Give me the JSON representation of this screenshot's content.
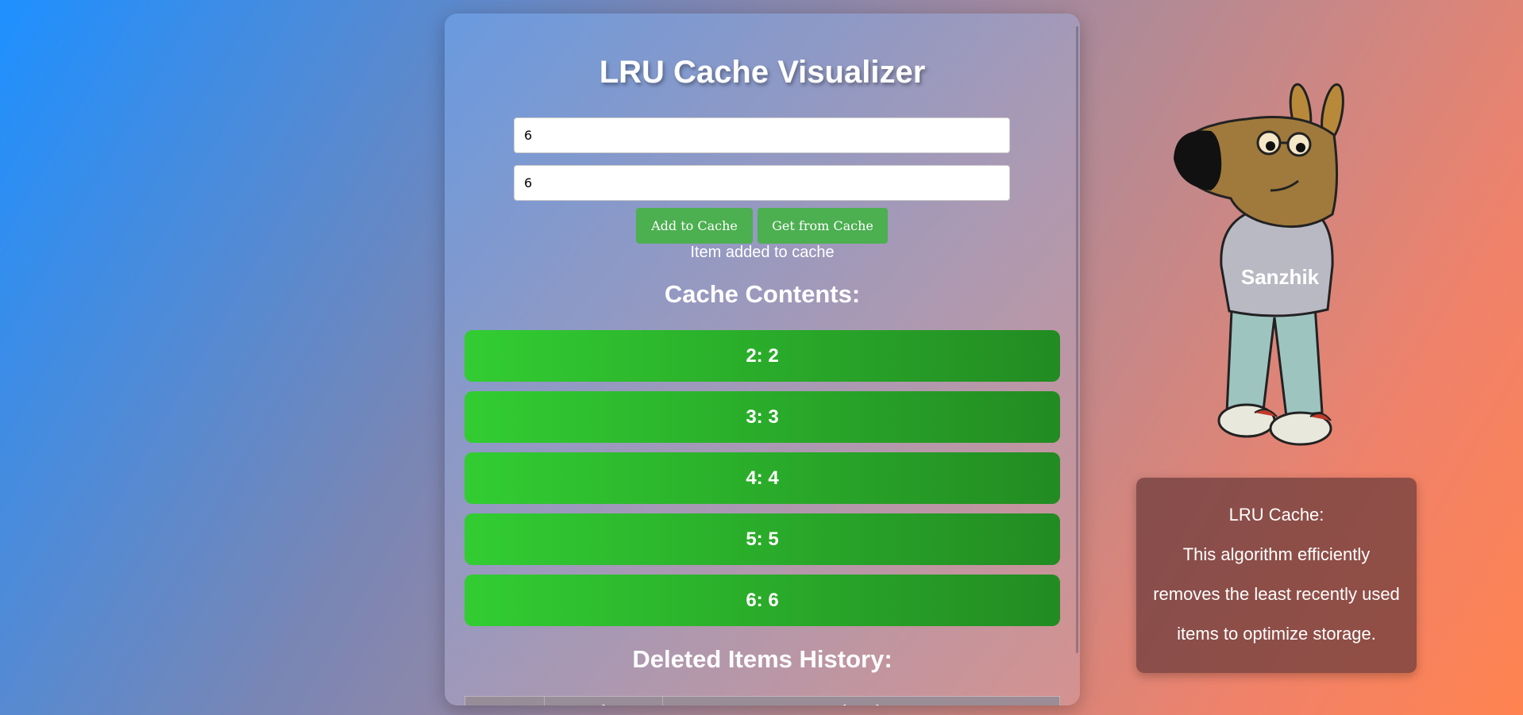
{
  "app": {
    "title": "LRU Cache Visualizer"
  },
  "form": {
    "key_value": "6",
    "value_value": "6",
    "add_button": "Add to Cache",
    "get_button": "Get from Cache"
  },
  "status_message": "Item added to cache",
  "cache": {
    "heading": "Cache Contents:",
    "items": [
      "2: 2",
      "3: 3",
      "4: 4",
      "5: 5",
      "6: 6"
    ]
  },
  "deleted_history": {
    "heading": "Deleted Items History:",
    "columns": [
      "Key",
      "Value",
      "Deleted At"
    ]
  },
  "mascot": {
    "name": "Sanzhik",
    "icon": "cartoon-dog-mascot"
  },
  "info": {
    "title": "LRU Cache:",
    "lines": [
      "This algorithm efficiently",
      "removes the least recently used",
      "items to optimize storage."
    ]
  },
  "colors": {
    "button": "#4caf50",
    "item_start": "#32cd32",
    "item_end": "#228b22"
  }
}
